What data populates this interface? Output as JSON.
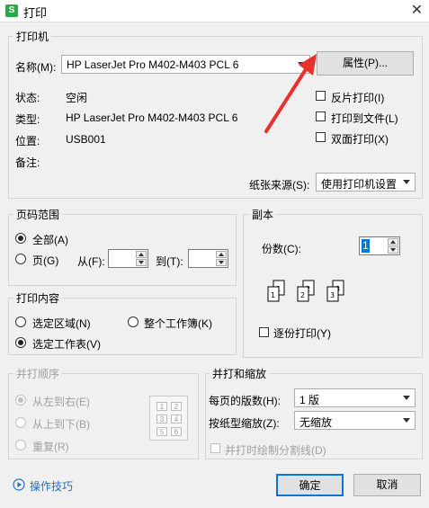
{
  "window": {
    "title": "打印",
    "app_icon": "S"
  },
  "printer_group": {
    "title": "打印机",
    "name_label": "名称(M):",
    "name_value": "HP LaserJet Pro M402-M403 PCL 6",
    "properties_button": "属性(P)...",
    "status_label": "状态:",
    "status_value": "空闲",
    "type_label": "类型:",
    "type_value": "HP LaserJet Pro M402-M403 PCL 6",
    "location_label": "位置:",
    "location_value": "USB001",
    "comment_label": "备注:",
    "reverse_print": "反片打印(I)",
    "print_to_file": "打印到文件(L)",
    "duplex_print": "双面打印(X)",
    "paper_source_label": "纸张来源(S):",
    "paper_source_value": "使用打印机设置"
  },
  "page_range": {
    "title": "页码范围",
    "all": "全部(A)",
    "pages": "页(G)",
    "from": "从(F):",
    "to": "到(T):"
  },
  "copies": {
    "title": "副本",
    "count_label": "份数(C):",
    "count_value": "1",
    "collate": "逐份打印(Y)",
    "icons": [
      "1",
      "1",
      "2",
      "2",
      "3",
      "3"
    ]
  },
  "print_content": {
    "title": "打印内容",
    "selection": "选定区域(N)",
    "whole_workbook": "整个工作簿(K)",
    "selected_sheet": "选定工作表(V)"
  },
  "collate_order": {
    "title": "并打顺序",
    "left_to_right": "从左到右(E)",
    "top_to_bottom": "从上到下(B)",
    "repeat": "重复(R)",
    "grid": [
      "1",
      "2",
      "3",
      "4",
      "5",
      "6"
    ]
  },
  "zoom": {
    "title": "并打和缩放",
    "pages_per_sheet_label": "每页的版数(H):",
    "pages_per_sheet_value": "1 版",
    "scale_label": "按纸型缩放(Z):",
    "scale_value": "无缩放",
    "draw_lines": "并打时绘制分割线(D)"
  },
  "footer": {
    "tips": "操作技巧",
    "ok": "确定",
    "cancel": "取消"
  },
  "colors": {
    "arrow": "#e8312a",
    "link": "#1e6fc8"
  }
}
